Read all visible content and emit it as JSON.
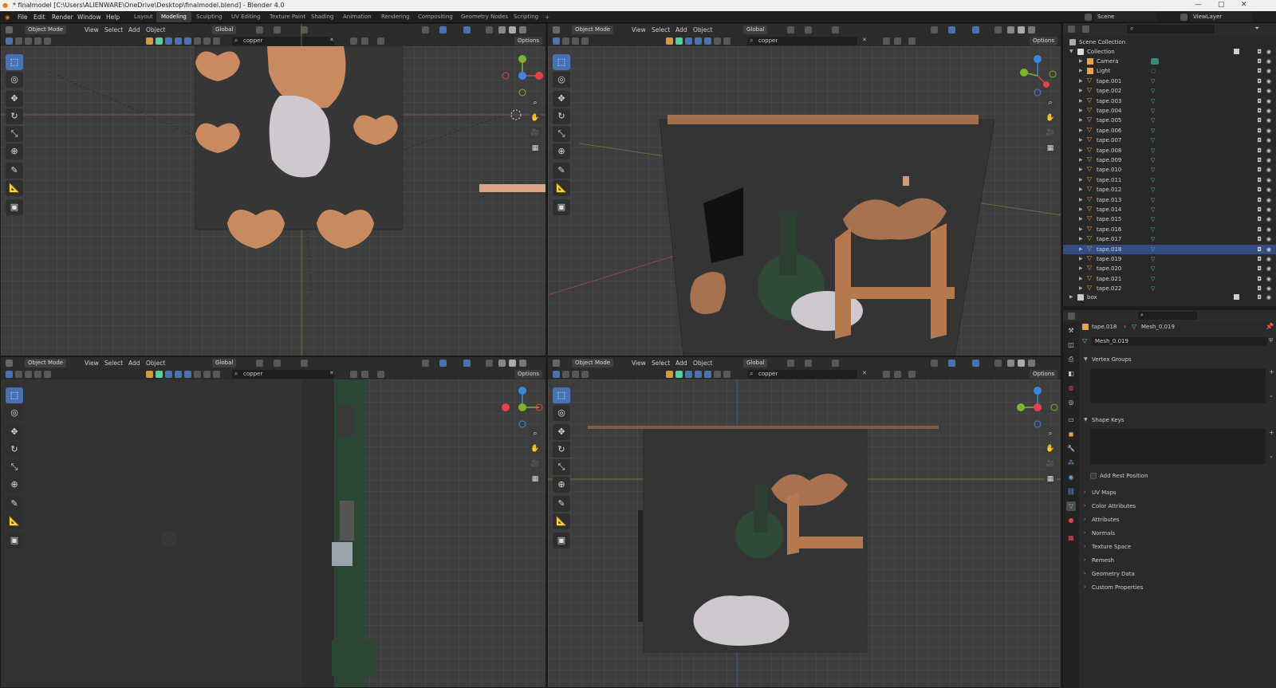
{
  "app": {
    "title": "* finalmodel [C:\\Users\\ALIENWARE\\OneDrive\\Desktop\\finalmodel.blend] - Blender 4.0",
    "menu": [
      "File",
      "Edit",
      "Render",
      "Window",
      "Help"
    ],
    "workspaces": [
      "Layout",
      "Modeling",
      "Sculpting",
      "UV Editing",
      "Texture Paint",
      "Shading",
      "Animation",
      "Rendering",
      "Compositing",
      "Geometry Nodes",
      "Scripting"
    ],
    "active_workspace": "Modeling",
    "scene": "Scene",
    "view_layer": "ViewLayer"
  },
  "viewport_common": {
    "mode": "Object Mode",
    "view": "View",
    "select": "Select",
    "add": "Add",
    "object": "Object",
    "orientation": "Global",
    "filter_value": "copper",
    "options": "Options"
  },
  "gizmo_axes": {
    "x": "X",
    "y": "Y",
    "z": "Z"
  },
  "outliner": {
    "root": "Scene Collection",
    "collection": "Collection",
    "items": [
      "Camera",
      "Light",
      "tape.001",
      "tape.002",
      "tape.003",
      "tape.004",
      "tape.005",
      "tape.006",
      "tape.007",
      "tape.008",
      "tape.009",
      "tape.010",
      "tape.011",
      "tape.012",
      "tape.013",
      "tape.014",
      "tape.015",
      "tape.016",
      "tape.017",
      "tape.018",
      "tape.019",
      "tape.020",
      "tape.021",
      "tape.022"
    ],
    "last_item": "box"
  },
  "properties": {
    "object": "tape.018",
    "mesh": "Mesh_0.019",
    "mesh_field": "Mesh_0.019",
    "sections_open": [
      "Vertex Groups",
      "Shape Keys"
    ],
    "add_rest_position": "Add Rest Position",
    "sections_closed": [
      "UV Maps",
      "Color Attributes",
      "Attributes",
      "Normals",
      "Texture Space",
      "Remesh",
      "Geometry Data",
      "Custom Properties"
    ]
  },
  "colors": {
    "copper": "#c98a62",
    "active_blue": "#4772b3",
    "axis_x": "#e0434b",
    "axis_y": "#7ab531",
    "axis_z": "#3d86e0",
    "outliner_mesh": "#4fd1a0"
  }
}
